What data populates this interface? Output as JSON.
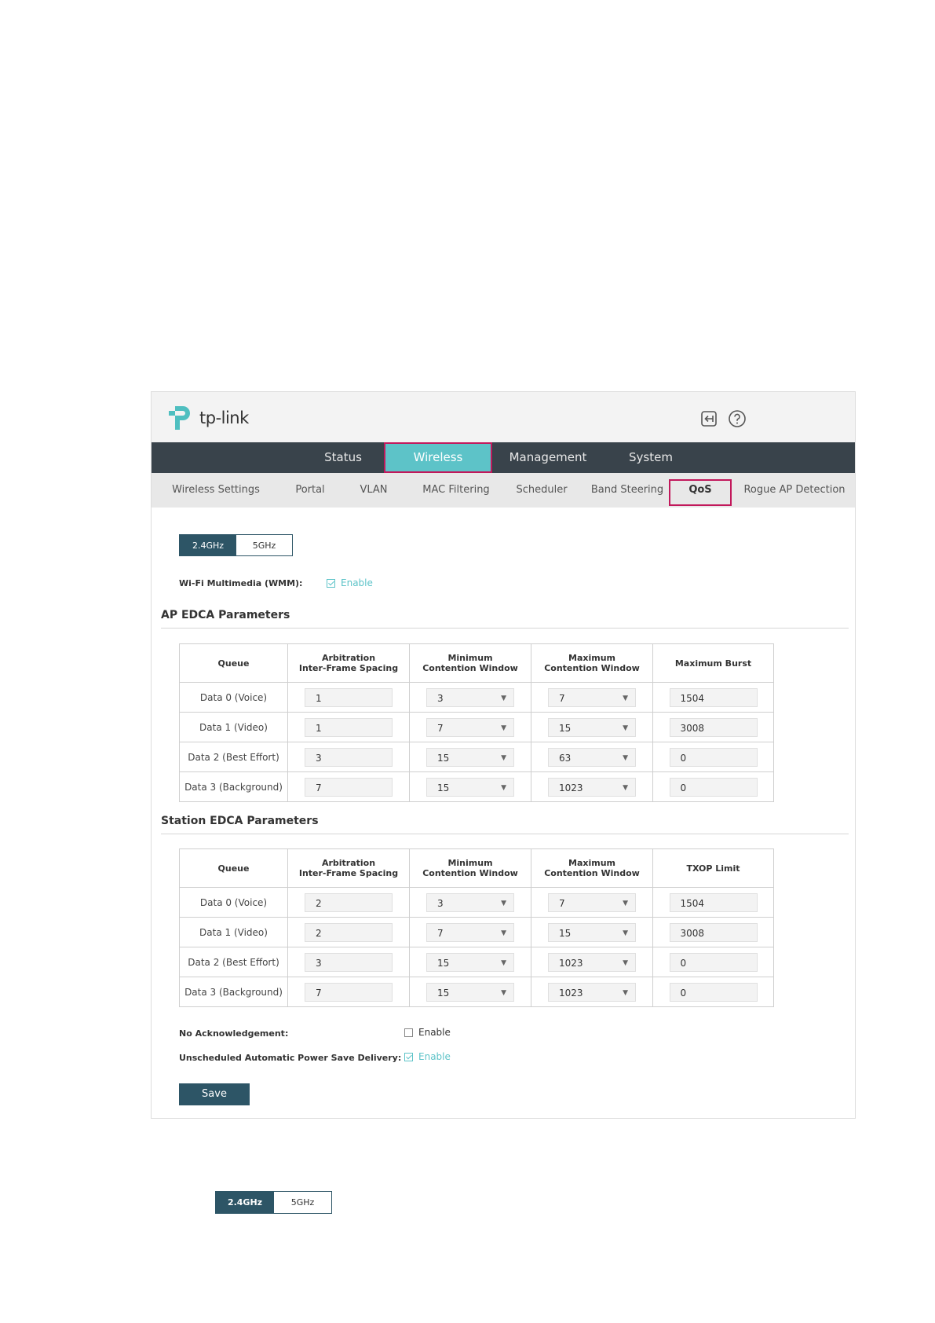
{
  "header": {
    "logo_text": "tp-link",
    "logout_icon": "logout-icon",
    "help_icon": "help-icon"
  },
  "topnav": [
    {
      "label": "Status"
    },
    {
      "label": "Wireless",
      "active": true
    },
    {
      "label": "Management"
    },
    {
      "label": "System"
    }
  ],
  "subnav": [
    {
      "label": "Wireless Settings"
    },
    {
      "label": "Portal"
    },
    {
      "label": "VLAN"
    },
    {
      "label": "MAC Filtering"
    },
    {
      "label": "Scheduler"
    },
    {
      "label": "Band Steering"
    },
    {
      "label": "QoS",
      "active": true
    },
    {
      "label": "Rogue AP Detection"
    }
  ],
  "band": {
    "selected": "2.4GHz",
    "options": [
      "2.4GHz",
      "5GHz"
    ]
  },
  "wmm": {
    "label": "Wi-Fi Multimedia (WMM):",
    "checkbox_label": "Enable",
    "checked": true
  },
  "ap_edca": {
    "title": "AP EDCA Parameters",
    "headers": [
      "Queue",
      "Arbitration\nInter-Frame Spacing",
      "Minimum\nContention Window",
      "Maximum\nContention Window",
      "Maximum Burst"
    ],
    "rows": [
      {
        "queue": "Data 0 (Voice)",
        "aifs": "1",
        "cwmin": "3",
        "cwmax": "7",
        "last": "1504"
      },
      {
        "queue": "Data 1 (Video)",
        "aifs": "1",
        "cwmin": "7",
        "cwmax": "15",
        "last": "3008"
      },
      {
        "queue": "Data 2 (Best Effort)",
        "aifs": "3",
        "cwmin": "15",
        "cwmax": "63",
        "last": "0"
      },
      {
        "queue": "Data 3 (Background)",
        "aifs": "7",
        "cwmin": "15",
        "cwmax": "1023",
        "last": "0"
      }
    ]
  },
  "station_edca": {
    "title": "Station EDCA Parameters",
    "headers": [
      "Queue",
      "Arbitration\nInter-Frame Spacing",
      "Minimum\nContention Window",
      "Maximum\nContention Window",
      "TXOP Limit"
    ],
    "rows": [
      {
        "queue": "Data 0 (Voice)",
        "aifs": "2",
        "cwmin": "3",
        "cwmax": "7",
        "last": "1504"
      },
      {
        "queue": "Data 1 (Video)",
        "aifs": "2",
        "cwmin": "7",
        "cwmax": "15",
        "last": "3008"
      },
      {
        "queue": "Data 2 (Best Effort)",
        "aifs": "3",
        "cwmin": "15",
        "cwmax": "1023",
        "last": "0"
      },
      {
        "queue": "Data 3 (Background)",
        "aifs": "7",
        "cwmin": "15",
        "cwmax": "1023",
        "last": "0"
      }
    ]
  },
  "no_ack": {
    "label": "No Acknowledgement:",
    "checkbox_label": "Enable",
    "checked": false
  },
  "uapsd": {
    "label": "Unscheduled Automatic Power Save Delivery:",
    "checkbox_label": "Enable",
    "checked": true
  },
  "save_label": "Save",
  "bottom_band": {
    "selected": "2.4GHz",
    "options": [
      "2.4GHz",
      "5GHz"
    ]
  },
  "colors": {
    "nav_bg": "#39434b",
    "accent": "#5dc3c8",
    "highlight": "#c2185b",
    "primary": "#2d5566"
  }
}
